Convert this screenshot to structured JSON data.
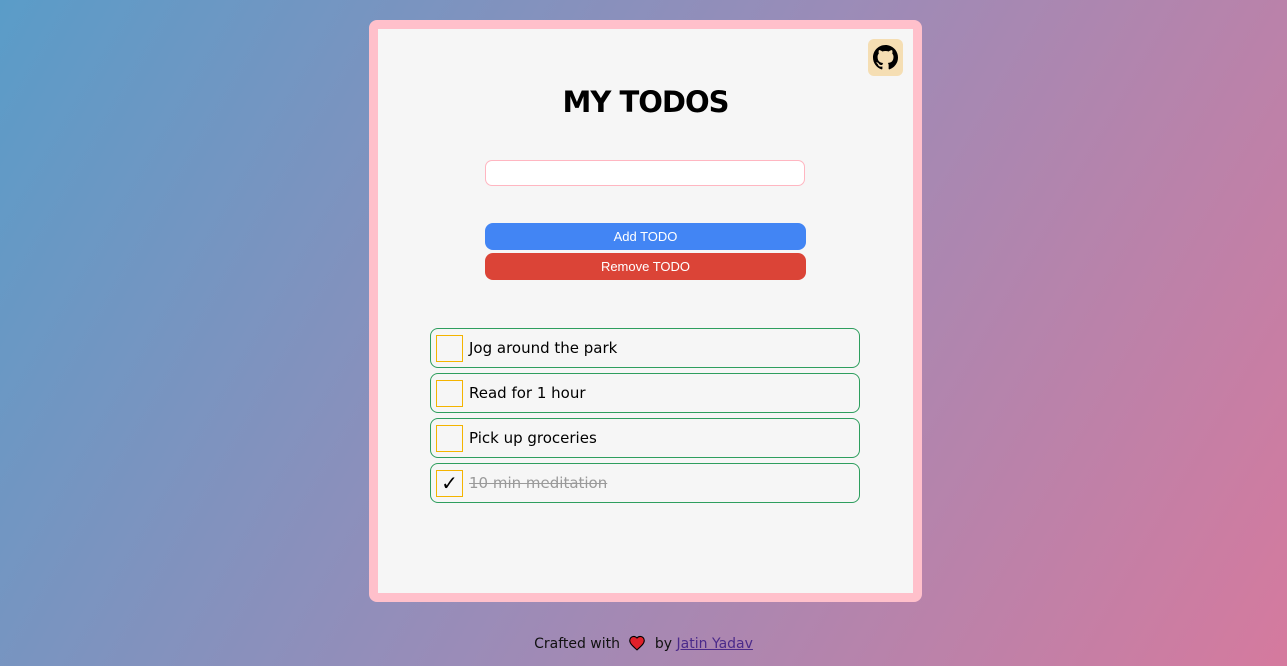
{
  "app": {
    "title": "MY TODOS",
    "input": {
      "value": "",
      "placeholder": ""
    },
    "buttons": {
      "add_label": "Add TODO",
      "remove_label": "Remove TODO"
    },
    "github_icon": "github-icon"
  },
  "todos": [
    {
      "text": "Jog around the park",
      "done": false
    },
    {
      "text": "Read for 1 hour",
      "done": false
    },
    {
      "text": "Pick up groceries",
      "done": false
    },
    {
      "text": "10 min meditation",
      "done": true
    }
  ],
  "check_mark": "✓",
  "footer": {
    "prefix": "Crafted with",
    "icon": "heart-icon",
    "by": "by",
    "author": "Jatin Yadav"
  },
  "colors": {
    "card_border": "#ffc0cb",
    "add_button": "#4285f4",
    "remove_button": "#db4437",
    "item_border": "#2e9e5e",
    "checkbox_border": "#f4b400",
    "github_bg": "#f5deb3"
  }
}
